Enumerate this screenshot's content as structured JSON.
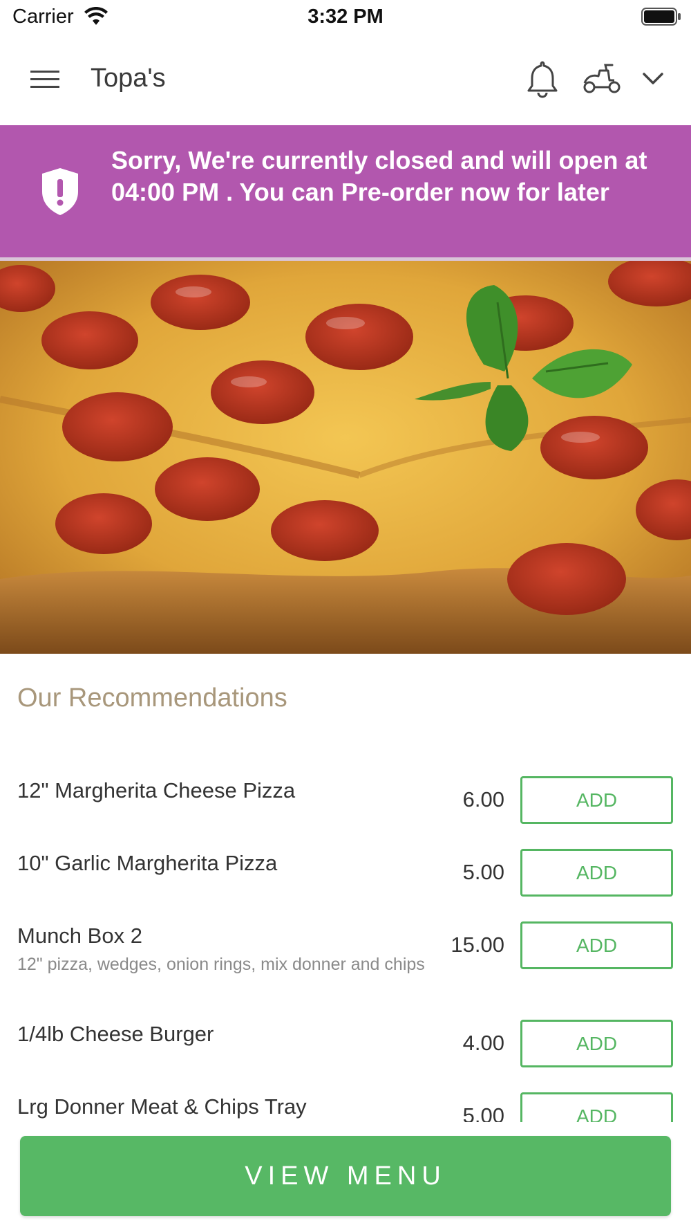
{
  "status_bar": {
    "carrier": "Carrier",
    "time": "3:32 PM"
  },
  "header": {
    "title": "Topa's",
    "icons": [
      "menu-icon",
      "bell-icon",
      "scooter-icon",
      "chevron-down-icon"
    ]
  },
  "banner": {
    "text": "Sorry, We're currently closed and will open at 04:00 PM . You can Pre-order now for later",
    "icon": "shield-icon",
    "color": "#b257ae"
  },
  "recommendations": {
    "title": "Our Recommendations",
    "items": [
      {
        "name": "12\" Margherita Cheese Pizza",
        "description": "",
        "price": "6.00",
        "button": "ADD"
      },
      {
        "name": "10\" Garlic Margherita Pizza",
        "description": "",
        "price": "5.00",
        "button": "ADD"
      },
      {
        "name": "Munch Box 2",
        "description": "12\" pizza, wedges, onion rings, mix donner and chips",
        "price": "15.00",
        "button": "ADD"
      },
      {
        "name": "1/4lb Cheese Burger",
        "description": "",
        "price": "4.00",
        "button": "ADD"
      },
      {
        "name": "Lrg Donner Meat & Chips Tray",
        "description": "",
        "price": "5.00",
        "button": "ADD"
      }
    ]
  },
  "cta": {
    "label": "VIEW MENU",
    "color": "#57b865"
  }
}
